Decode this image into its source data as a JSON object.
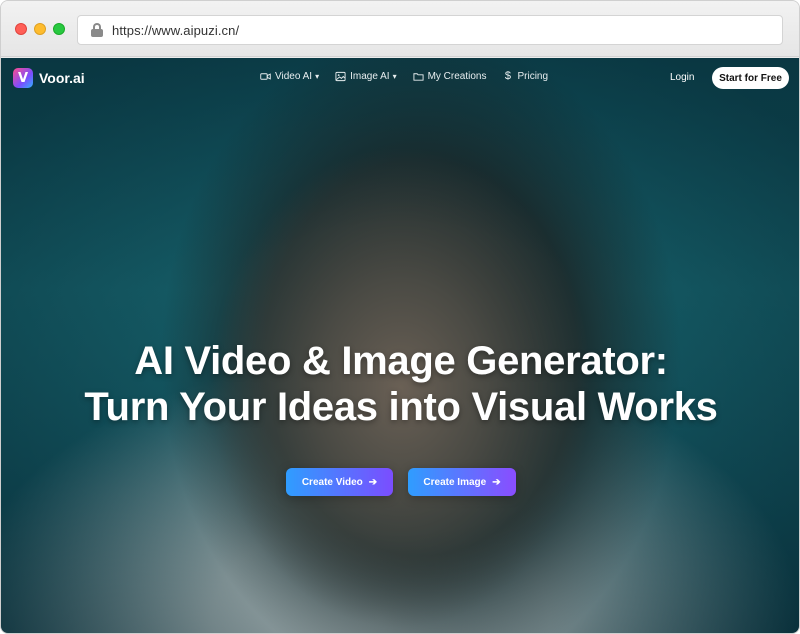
{
  "browser": {
    "url": "https://www.aipuzi.cn/"
  },
  "nav": {
    "logo_mark": "V",
    "logo_text": "Voor.ai",
    "items": [
      {
        "label": "Video AI",
        "icon": "video-camera-icon",
        "dropdown": true
      },
      {
        "label": "Image AI",
        "icon": "image-icon",
        "dropdown": true
      },
      {
        "label": "My Creations",
        "icon": "folder-icon",
        "dropdown": false
      },
      {
        "label": "Pricing",
        "icon": "dollar-icon",
        "dropdown": false
      }
    ],
    "login": "Login",
    "start_free": "Start for Free"
  },
  "hero": {
    "title_line1": "AI Video & Image Generator:",
    "title_line2": "Turn Your Ideas into Visual Works",
    "create_video": "Create Video",
    "create_image": "Create Image",
    "arrow": "➔"
  },
  "colors": {
    "accent_start": "#2f9dff",
    "accent_end": "#7b4dff",
    "background": "#155c66"
  }
}
